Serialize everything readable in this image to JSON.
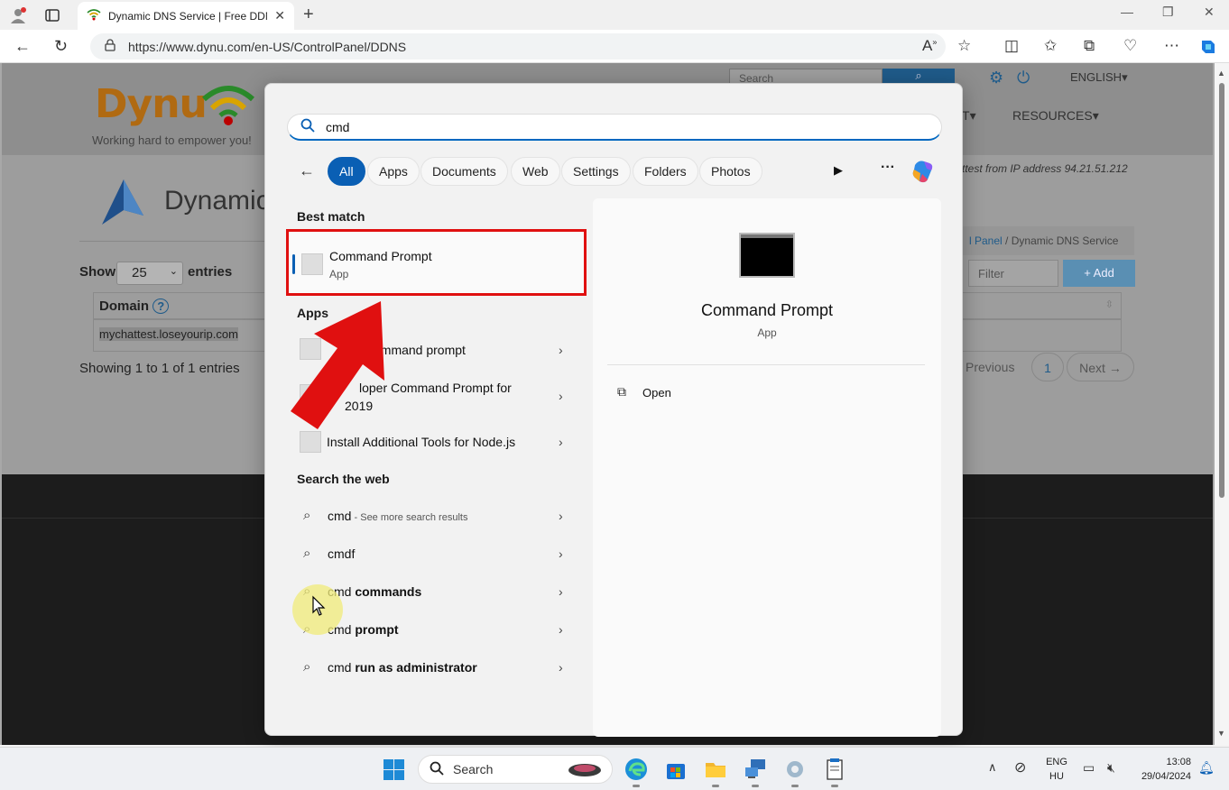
{
  "browser": {
    "tab_title": "Dynamic DNS Service | Free DDN",
    "url": "https://www.dynu.com/en-US/ControlPanel/DDNS"
  },
  "site": {
    "logo_text": "Dynu",
    "tagline": "Working hard to empower you!",
    "page_title": "Dynamic",
    "search_placeholder": "Search",
    "language": "ENGLISH",
    "nav_t_suffix": "T",
    "resources": "RESOURCES",
    "request_ip": "ttest from IP address 94.21.51.212",
    "breadcrumb_link": "l Panel",
    "breadcrumb_sep": "/",
    "breadcrumb_current": "Dynamic DNS Service",
    "filter_placeholder": "Filter",
    "add_label": "+ Add",
    "show_label": "Show",
    "show_value": "25",
    "entries_label": "entries",
    "domain_header": "Domain",
    "domain_value": "mychattest.loseyourip.com",
    "showing_text": "Showing 1 to 1 of 1 entries",
    "previous": "Previous",
    "page": "1",
    "next": "Next →"
  },
  "start_menu": {
    "search_value": "cmd",
    "filters": [
      "All",
      "Apps",
      "Documents",
      "Web",
      "Settings",
      "Folders",
      "Photos"
    ],
    "best_match_title": "Best match",
    "best_match": {
      "name": "Command Prompt",
      "type": "App"
    },
    "apps_title": "Apps",
    "apps": [
      {
        "name": "ommand prompt"
      },
      {
        "name": "loper Command Prompt for",
        "line2": "2019"
      },
      {
        "name": "Install Additional Tools for Node.js"
      }
    ],
    "web_title": "Search the web",
    "web": [
      {
        "plain": "cmd",
        "extra": " - See more search results",
        "bold": ""
      },
      {
        "plain": "cmdf",
        "extra": "",
        "bold": ""
      },
      {
        "plain": "cmd ",
        "extra": "",
        "bold": "commands"
      },
      {
        "plain": "cmd ",
        "extra": "",
        "bold": "prompt"
      },
      {
        "plain": "cmd ",
        "extra": "",
        "bold": "run as administrator"
      }
    ],
    "preview": {
      "name": "Command Prompt",
      "type": "App",
      "open": "Open"
    }
  },
  "taskbar": {
    "search_label": "Search",
    "lang_line1": "ENG",
    "lang_line2": "HU",
    "time": "13:08",
    "date": "29/04/2024"
  },
  "colors": {
    "accent": "#0a5fb4",
    "highlight": "#e01010"
  }
}
